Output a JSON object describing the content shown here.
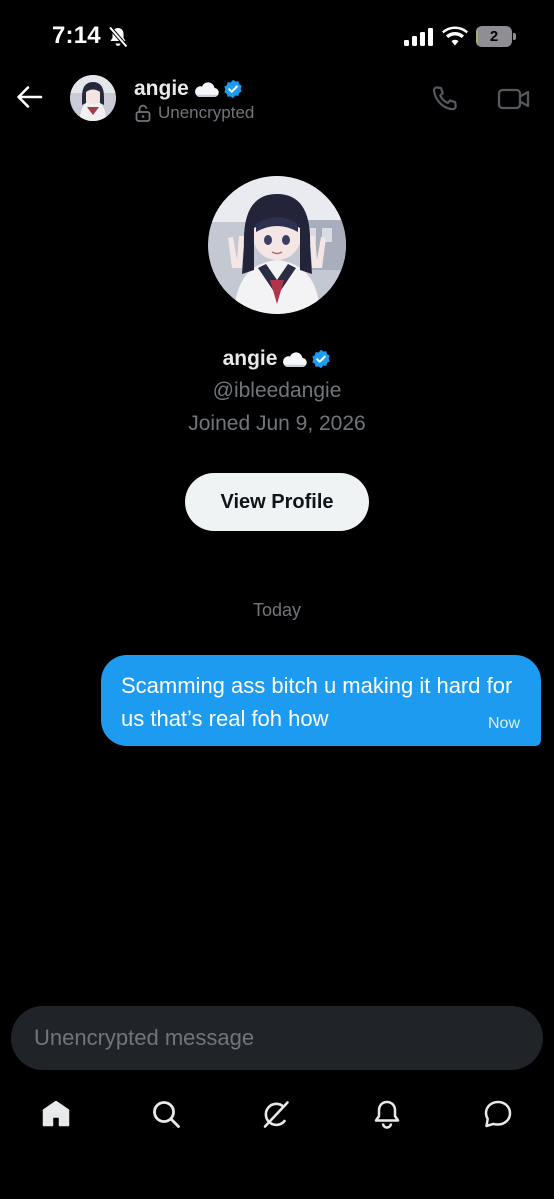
{
  "status_bar": {
    "time": "7:14",
    "battery_level": "2",
    "battery_fraction": 0.02
  },
  "header": {
    "name": "angie",
    "name_emoji": "cloud",
    "verified": true,
    "encryption_status": "Unencrypted",
    "icons": [
      "back-arrow-icon",
      "phone-icon",
      "video-camera-icon"
    ]
  },
  "profile": {
    "name": "angie",
    "handle": "@ibleedangie",
    "joined": "Joined Jun 9, 2026",
    "view_profile_label": "View Profile"
  },
  "conversation": {
    "day_label": "Today",
    "messages": [
      {
        "sender": "me",
        "text": "Scamming ass bitch u making it hard for us that’s real foh how",
        "time": "Now"
      }
    ]
  },
  "composer": {
    "placeholder": "Unencrypted message",
    "value": ""
  },
  "tab_bar": {
    "items": [
      "home-icon",
      "search-icon",
      "grok-icon",
      "notifications-icon",
      "messages-icon"
    ],
    "active": "home-icon"
  },
  "colors": {
    "accent": "#1d9bf0",
    "background": "#000000",
    "secondary_text": "#71767b",
    "button_bg": "#eff3f4"
  }
}
